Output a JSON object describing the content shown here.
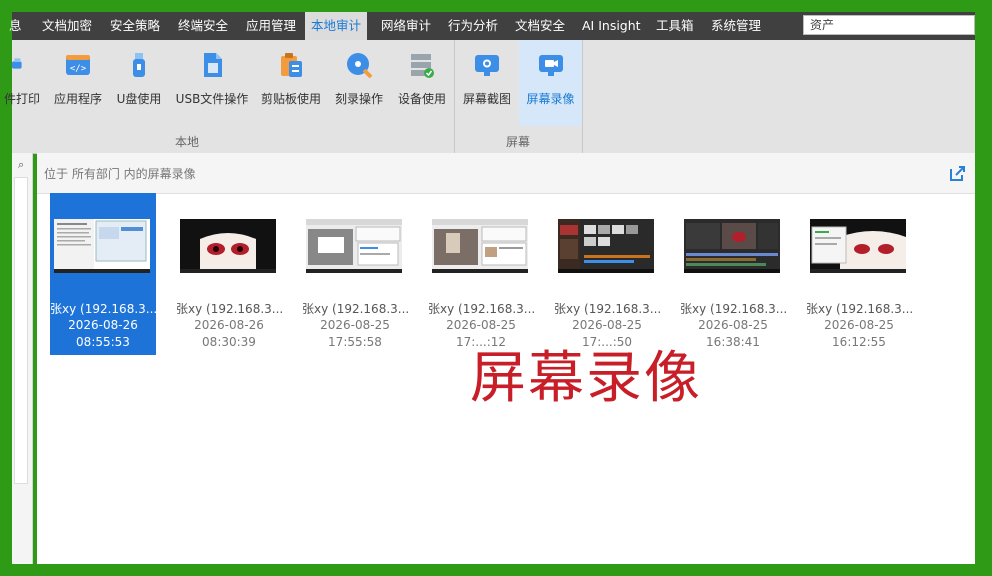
{
  "menu": {
    "items": [
      "息",
      "文档加密",
      "安全策略",
      "终端安全",
      "应用管理",
      "本地审计",
      "网络审计",
      "行为分析",
      "文档安全",
      "AI Insight",
      "工具箱",
      "系统管理"
    ],
    "active_index": 5
  },
  "search": {
    "value": "资产"
  },
  "ribbon": {
    "local_buttons": [
      "件打印",
      "应用程序",
      "U盘使用",
      "USB文件操作",
      "剪贴板使用",
      "刻录操作",
      "设备使用"
    ],
    "local_group": "本地",
    "screen_buttons": [
      "屏幕截图",
      "屏幕录像"
    ],
    "screen_group": "屏幕",
    "active": "屏幕录像"
  },
  "location": {
    "text": "位于 所有部门 内的屏幕录像"
  },
  "thumbnails": [
    {
      "name": "张xy (192.168.3...",
      "date": "2026-08-26",
      "time": "08:55:53",
      "style": "desktop-white"
    },
    {
      "name": "张xy (192.168.3...",
      "date": "2026-08-26",
      "time": "08:30:39",
      "style": "anime"
    },
    {
      "name": "张xy (192.168.3...",
      "date": "2026-08-25",
      "time": "17:55:58",
      "style": "desktop-gray"
    },
    {
      "name": "张xy (192.168.3...",
      "date": "2026-08-25",
      "time": "17:...:12",
      "style": "desktop-photo"
    },
    {
      "name": "张xy (192.168.3...",
      "date": "2026-08-25",
      "time": "17:...:50",
      "style": "dark-editor"
    },
    {
      "name": "张xy (192.168.3...",
      "date": "2026-08-25",
      "time": "16:38:41",
      "style": "dark-video"
    },
    {
      "name": "张xy (192.168.3...",
      "date": "2026-08-25",
      "time": "16:12:55",
      "style": "anime-window"
    }
  ],
  "overlay_caption": "屏幕录像",
  "colors": {
    "accent": "#1a7ad6",
    "selected": "#1e73d8",
    "frame": "#2e9a16",
    "caption": "#c81e28"
  }
}
